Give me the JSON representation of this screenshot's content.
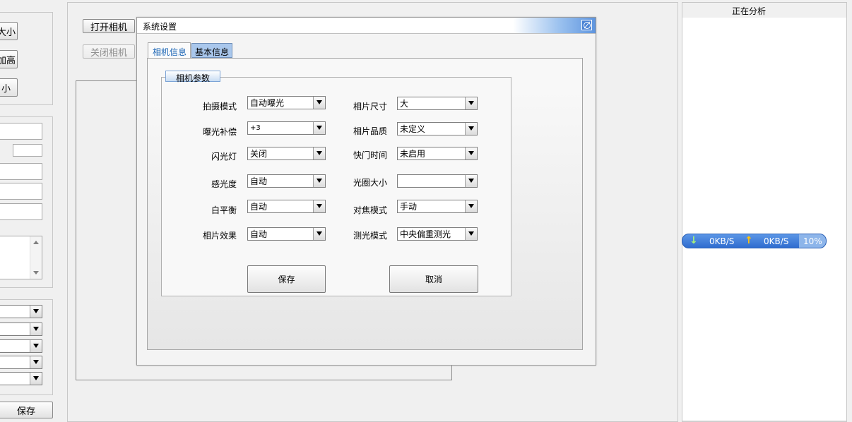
{
  "left_panel": {
    "size_buttons": [
      "大小",
      "加高",
      "小"
    ],
    "save_label": "保存"
  },
  "main": {
    "open_camera": "打开相机",
    "close_camera": "关闭相机"
  },
  "dialog": {
    "title": "系统设置",
    "tabs": [
      "相机信息",
      "基本信息"
    ],
    "group_title": "相机参数",
    "left_params": [
      {
        "label": "拍摄模式",
        "value": "自动曝光"
      },
      {
        "label": "曝光补偿",
        "value": "+3"
      },
      {
        "label": "闪光灯",
        "value": "关闭"
      },
      {
        "label": "感光度",
        "value": "自动"
      },
      {
        "label": "白平衡",
        "value": "自动"
      },
      {
        "label": "相片效果",
        "value": "自动"
      }
    ],
    "right_params": [
      {
        "label": "相片尺寸",
        "value": "大"
      },
      {
        "label": "相片品质",
        "value": "未定义"
      },
      {
        "label": "快门时间",
        "value": "未启用"
      },
      {
        "label": "光圈大小",
        "value": ""
      },
      {
        "label": "对焦模式",
        "value": "手动"
      },
      {
        "label": "测光模式",
        "value": "中央偏重测光"
      }
    ],
    "save_button": "保存",
    "cancel_button": "取消"
  },
  "right_panel": {
    "title": "正在分析"
  },
  "net_widget": {
    "down": "0KB/S",
    "up": "0KB/S",
    "percent": "10%"
  },
  "colors": {
    "tab_active_text": "#1a64b4",
    "tab_inactive_bg": "#a9c7ec",
    "net_bar": "#3f7fd8"
  }
}
